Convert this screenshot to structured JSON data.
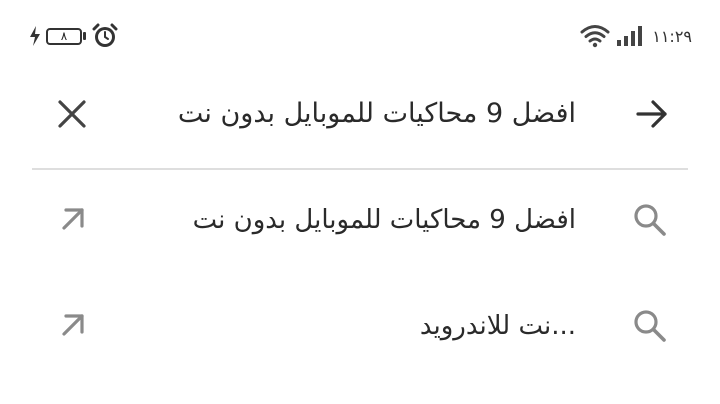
{
  "status_bar": {
    "battery_level": "٨",
    "time": "١١:٢٩",
    "icons": [
      "charging-bolt-icon",
      "battery-icon",
      "alarm-clock-icon",
      "wifi-icon",
      "cellular-signal-icon"
    ]
  },
  "search": {
    "query": "افضل 9 محاكيات للموبايل بدون نت",
    "back_icon": "arrow-right-icon",
    "clear_icon": "close-icon"
  },
  "suggestions": [
    {
      "text": "افضل 9 محاكيات للموبايل بدون نت",
      "icon": "search-icon",
      "action_icon": "arrow-up-left-icon"
    },
    {
      "text": "...نت للاندرويد",
      "icon": "search-icon",
      "action_icon": "arrow-up-left-icon"
    }
  ],
  "colors": {
    "text": "#2a2a2a",
    "icon_gray": "#8a8a8a",
    "divider": "#dedede",
    "background": "#ffffff"
  }
}
